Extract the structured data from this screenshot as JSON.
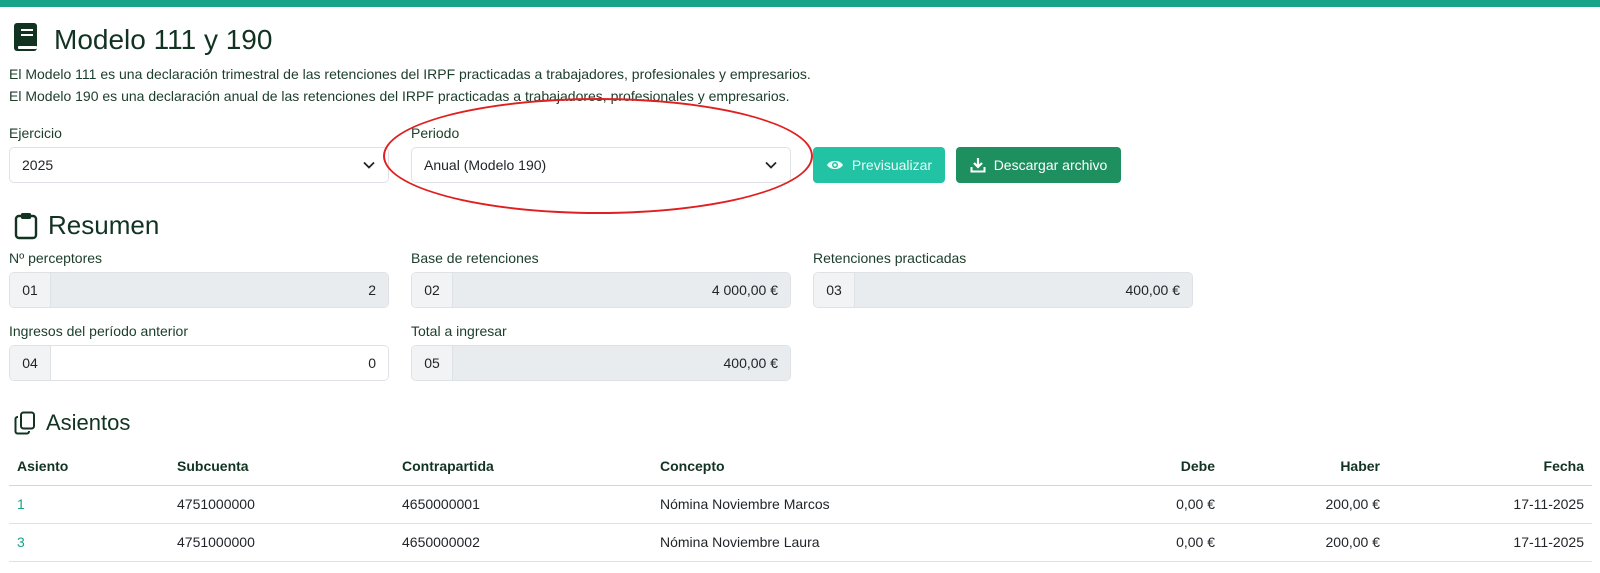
{
  "header": {
    "title": "Modelo 111 y 190",
    "description_line1": "El Modelo 111 es una declaración trimestral de las retenciones del IRPF practicadas a trabajadores, profesionales y empresarios.",
    "description_line2": "El Modelo 190 es una declaración anual de las retenciones del IRPF practicadas a trabajadores, profesionales y empresarios."
  },
  "filters": {
    "ejercicio_label": "Ejercicio",
    "ejercicio_value": "2025",
    "periodo_label": "Periodo",
    "periodo_value": "Anual (Modelo 190)",
    "preview_label": "Previsualizar",
    "download_label": "Descargar archivo"
  },
  "summary": {
    "title": "Resumen",
    "fields": [
      {
        "label": "Nº perceptores",
        "code": "01",
        "value": "2"
      },
      {
        "label": "Base de retenciones",
        "code": "02",
        "value": "4 000,00 €"
      },
      {
        "label": "Retenciones practicadas",
        "code": "03",
        "value": "400,00 €"
      },
      {
        "label": "Ingresos del período anterior",
        "code": "04",
        "value": "0"
      },
      {
        "label": "Total a ingresar",
        "code": "05",
        "value": "400,00 €"
      }
    ]
  },
  "entries": {
    "title": "Asientos",
    "columns": [
      "Asiento",
      "Subcuenta",
      "Contrapartida",
      "Concepto",
      "Debe",
      "Haber",
      "Fecha"
    ],
    "rows": [
      {
        "asiento": "1",
        "subcuenta": "4751000000",
        "contrapartida": "4650000001",
        "concepto": "Nómina Noviembre Marcos",
        "debe": "0,00 €",
        "haber": "200,00 €",
        "fecha": "17-11-2025"
      },
      {
        "asiento": "3",
        "subcuenta": "4751000000",
        "contrapartida": "4650000002",
        "concepto": "Nómina Noviembre Laura",
        "debe": "0,00 €",
        "haber": "200,00 €",
        "fecha": "17-11-2025"
      }
    ]
  },
  "colors": {
    "accent": "#17a589",
    "preview_button": "#22c2a4",
    "download_button": "#1e8f5e",
    "annotation": "#e02020"
  }
}
